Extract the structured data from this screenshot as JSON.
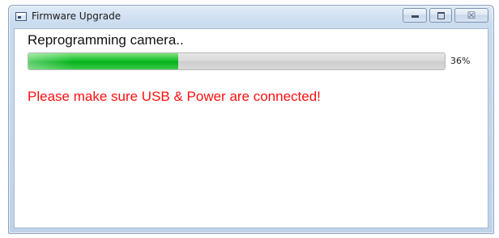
{
  "window": {
    "title": "Firmware Upgrade",
    "controls": {
      "minimize_icon": "minimize-icon",
      "maximize_icon": "maximize-icon",
      "close_icon": "close-icon",
      "close_glyph": "☒"
    }
  },
  "content": {
    "status": "Reprogramming camera..",
    "progress": {
      "value": 36,
      "label": "36%",
      "fill_color": "#18c02c",
      "track_color": "#d6d6d6"
    },
    "warning": {
      "text": "Please make sure USB & Power are connected!",
      "color": "#ff1010"
    }
  }
}
